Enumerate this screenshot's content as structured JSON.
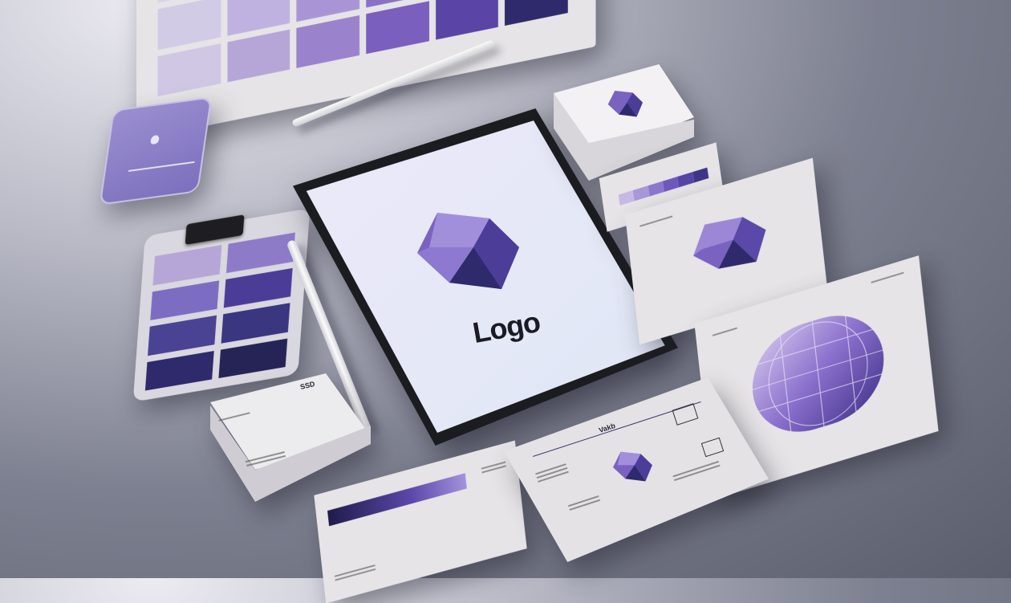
{
  "tablet": {
    "logo_text": "Logo"
  },
  "business_card": {
    "brand_text": "SSD"
  },
  "letterhead": {
    "brand_text": "Vakb"
  },
  "colors": {
    "purple_light": "#b6a6d8",
    "purple_mid": "#7b5fbe",
    "purple_deep": "#4b3d97",
    "indigo_dark": "#2f2a6b",
    "paper": "#e6e4e6",
    "tablet_bezel": "#1b1c1f"
  },
  "icons": [
    "hexagon-logo-icon",
    "apple-logo-icon",
    "binder-clip-icon"
  ]
}
